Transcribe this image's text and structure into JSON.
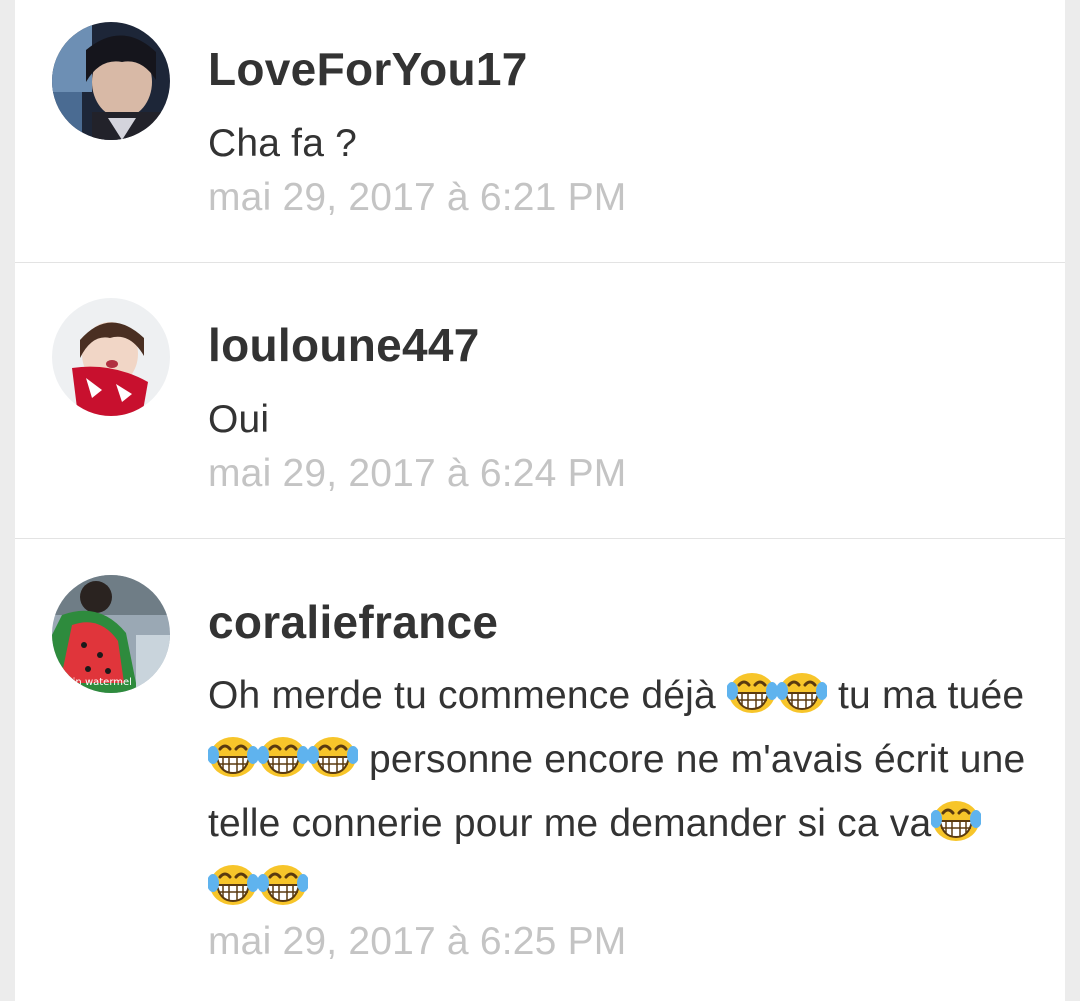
{
  "comments": [
    {
      "username": "LoveForYou17",
      "text": "Cha fa ?",
      "timestamp": "mai 29, 2017 à 6:21 PM",
      "avatar_icon": "profile-photo"
    },
    {
      "username": "louloune447",
      "text": "Oui",
      "timestamp": "mai 29, 2017 à 6:24 PM",
      "avatar_icon": "profile-photo"
    },
    {
      "username": "coraliefrance",
      "text_parts": [
        "Oh merde tu commence déjà ",
        " tu ma tuée ",
        " personne encore ne m'avais écrit une telle connerie pour me demander si ca va"
      ],
      "emoji": "tears-of-joy",
      "emoji_counts": [
        2,
        3,
        3
      ],
      "avatar_caption": "ing in watermel",
      "timestamp": "mai 29, 2017 à 6:25 PM"
    }
  ],
  "colors": {
    "background": "#ececec",
    "panel": "#ffffff",
    "username": "#333333",
    "text": "#333333",
    "timestamp": "#c4c4c4",
    "divider": "#e3e3e3"
  }
}
